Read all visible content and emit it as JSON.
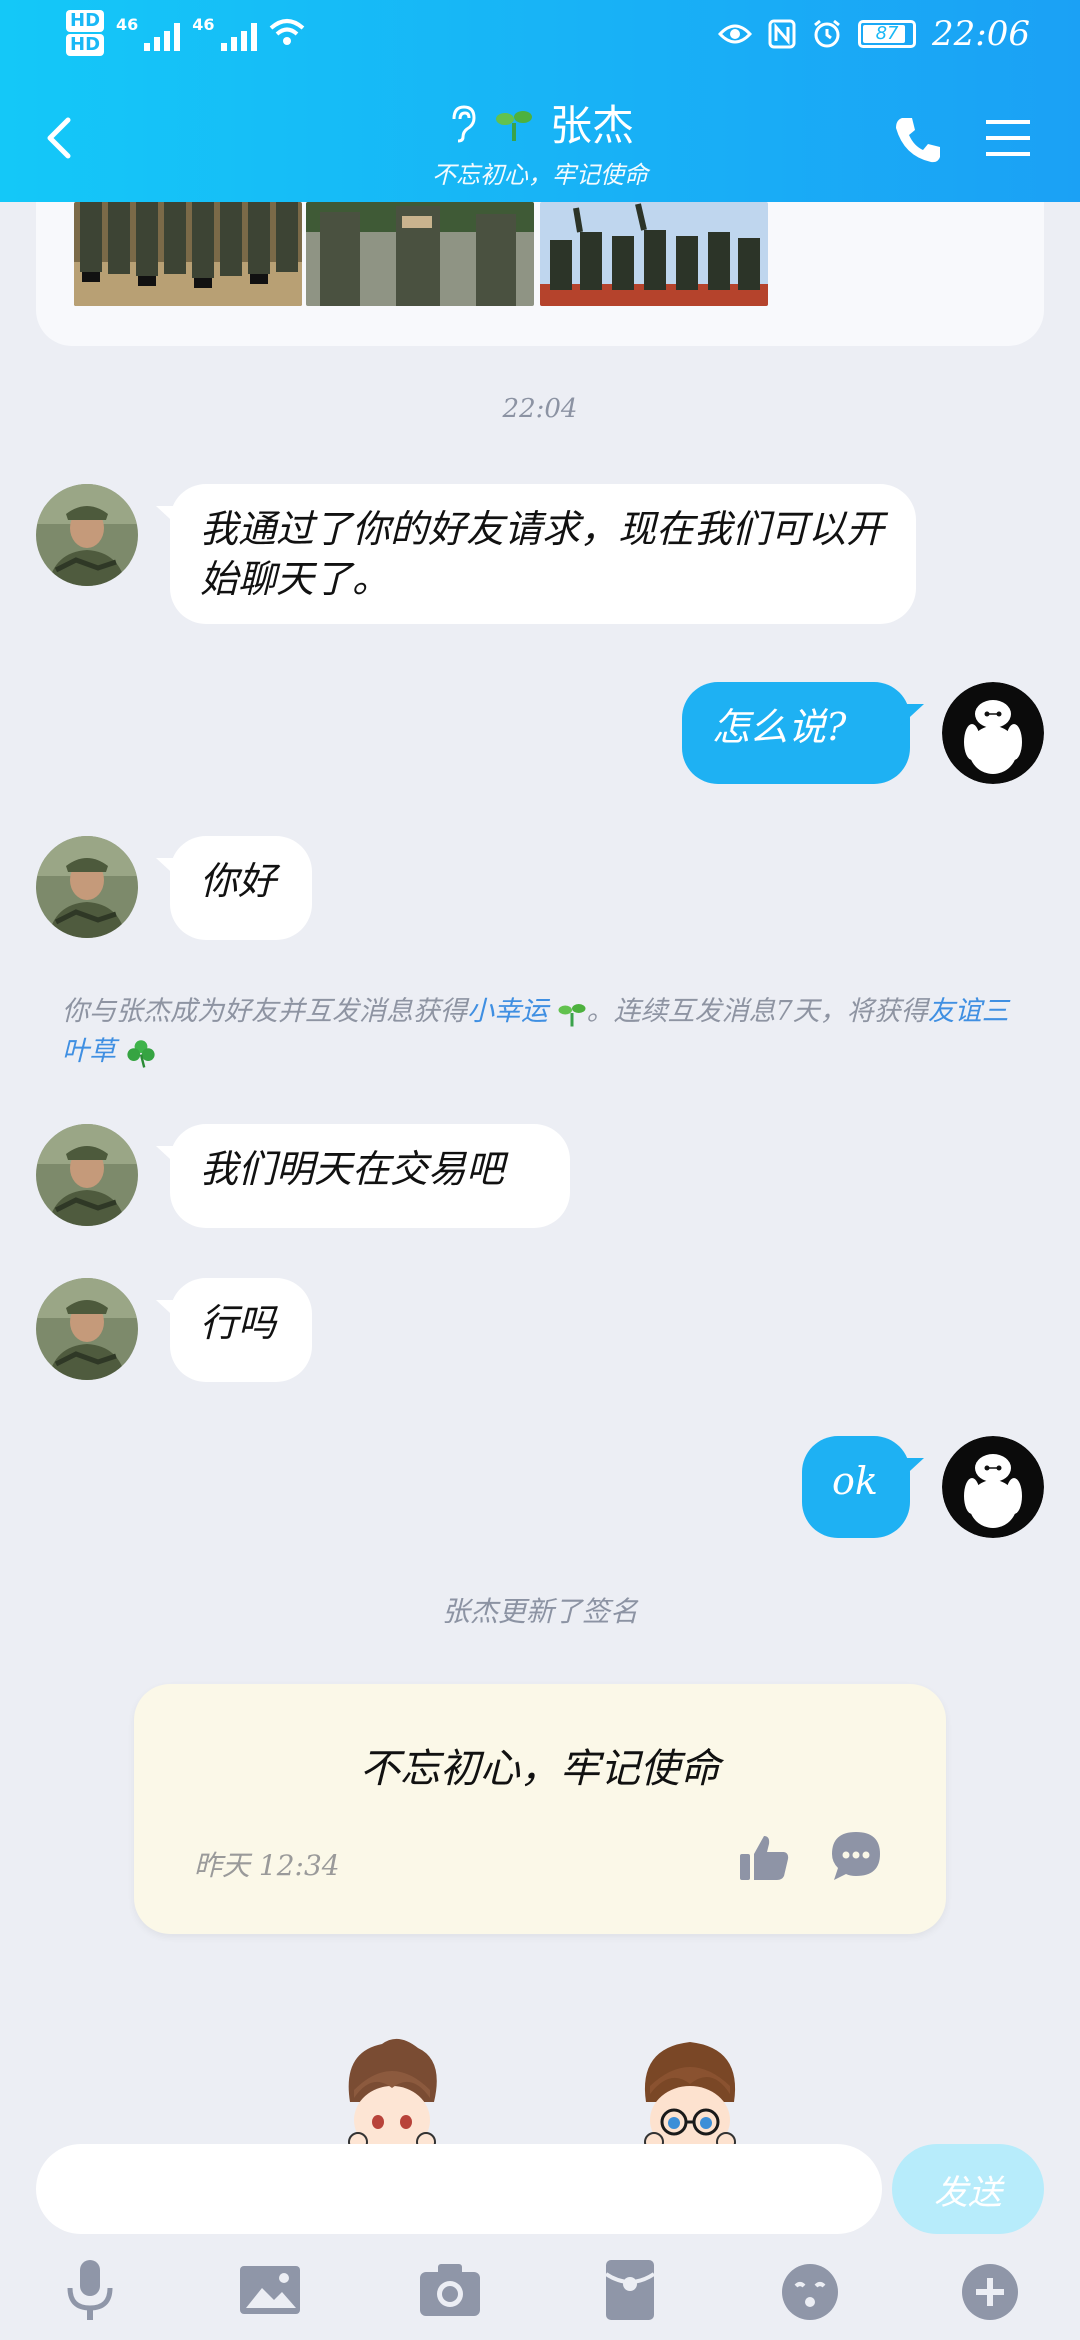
{
  "status_bar": {
    "hd1": "HD",
    "hd2": "HD",
    "net1": "46",
    "net2": "46",
    "battery": "87",
    "time": "22:06"
  },
  "header": {
    "contact_name": "张杰",
    "signature": "不忘初心，牢记使命"
  },
  "chat": {
    "time_1": "22:04",
    "messages": [
      {
        "side": "left",
        "text": "我通过了你的好友请求，现在我们可以开始聊天了。"
      },
      {
        "side": "right",
        "text": "怎么说?"
      },
      {
        "side": "left",
        "text": "你好"
      },
      {
        "side": "left",
        "text": "我们明天在交易吧"
      },
      {
        "side": "left",
        "text": "行吗"
      },
      {
        "side": "right",
        "text": "ok"
      }
    ],
    "system_notice": {
      "part1": "你与张杰成为好友并互发消息获得",
      "link1": "小幸运",
      "part2": "。连续互发消息7天，将获得",
      "link2": "友谊三叶草"
    },
    "signature_update": "张杰更新了签名"
  },
  "signature_card": {
    "text": "不忘初心，牢记使命",
    "date": "昨天 12:34",
    "like_icon": "thumbs-up-icon",
    "comment_icon": "comment-icon"
  },
  "input": {
    "placeholder": "",
    "send_label": "发送"
  },
  "toolbar": {
    "items": [
      "microphone-icon",
      "image-icon",
      "camera-icon",
      "red-packet-icon",
      "emoji-icon",
      "plus-icon"
    ]
  },
  "colors": {
    "header_gradient_start": "#14c8f8",
    "header_gradient_end": "#1ba1f5",
    "self_bubble": "#1eb1f3",
    "link": "#3f8fe2",
    "send_disabled": "#b7ecfb"
  }
}
